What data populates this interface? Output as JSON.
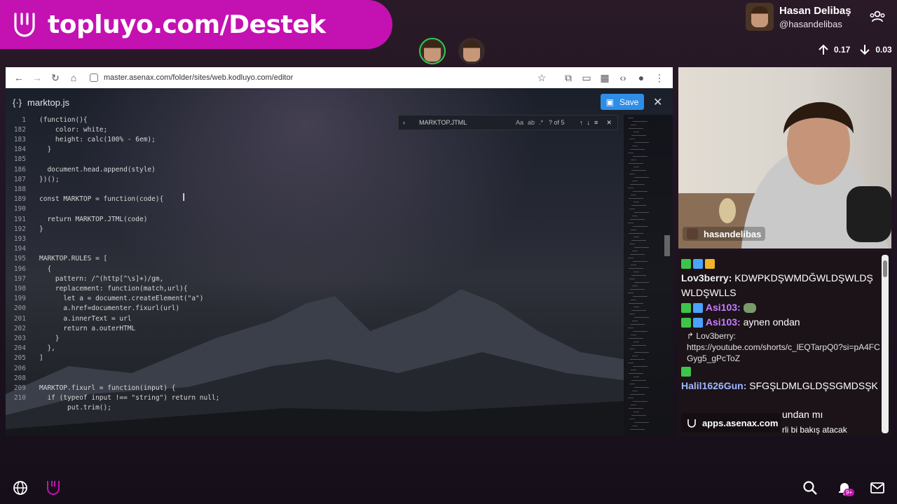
{
  "banner": {
    "text": "topluyo.com/Destek",
    "color": "#c411b2"
  },
  "profile": {
    "name": "Hasan Delibaş",
    "handle": "@hasandelibas"
  },
  "stats": {
    "upload": "0.17",
    "download": "0.03"
  },
  "browser": {
    "url": "master.asenax.com/folder/sites/web.kodluyo.com/editor"
  },
  "editor": {
    "file_name": "marktop.js",
    "save_label": "Save",
    "find": {
      "query": "MARKTOP.JTML",
      "count": "? of 5",
      "opt_case": "Aa",
      "opt_word": "ab",
      "opt_regex": ".*"
    },
    "lines": [
      {
        "n": "1",
        "t": "(function(){"
      },
      {
        "n": "182",
        "t": "    color: white;"
      },
      {
        "n": "183",
        "t": "    height: calc(100% - 6em);"
      },
      {
        "n": "184",
        "t": "  }"
      },
      {
        "n": "185",
        "t": ""
      },
      {
        "n": "186",
        "t": "  document.head.append(style)"
      },
      {
        "n": "187",
        "t": "})();"
      },
      {
        "n": "188",
        "t": ""
      },
      {
        "n": "189",
        "t": "const MARKTOP = function(code){"
      },
      {
        "n": "190",
        "t": ""
      },
      {
        "n": "191",
        "t": "  return MARKTOP.JTML(code)"
      },
      {
        "n": "192",
        "t": "}"
      },
      {
        "n": "193",
        "t": ""
      },
      {
        "n": "194",
        "t": ""
      },
      {
        "n": "195",
        "t": "MARKTOP.RULES = ["
      },
      {
        "n": "196",
        "t": "  {"
      },
      {
        "n": "197",
        "t": "    pattern: /^(http[^\\s]+)/gm,"
      },
      {
        "n": "198",
        "t": "    replacement: function(match,url){"
      },
      {
        "n": "199",
        "t": "      let a = document.createElement(\"a\")"
      },
      {
        "n": "200",
        "t": "      a.href=documenter.fixurl(url)"
      },
      {
        "n": "201",
        "t": "      a.innerText = url"
      },
      {
        "n": "202",
        "t": "      return a.outerHTML"
      },
      {
        "n": "203",
        "t": "    }"
      },
      {
        "n": "204",
        "t": "  },"
      },
      {
        "n": "205",
        "t": "]"
      },
      {
        "n": "206",
        "t": ""
      },
      {
        "n": "208",
        "t": ""
      },
      {
        "n": "209",
        "t": "MARKTOP.fixurl = function(input) {"
      },
      {
        "n": "210",
        "t": "  if (typeof input !== \"string\") return null;"
      },
      {
        "n": "",
        "t": "       put.trim();"
      }
    ],
    "cam_label": "hasandelibas"
  },
  "webcam": {
    "label": "hasandelibas"
  },
  "chat": {
    "messages": [
      {
        "user": "Lov3berry:",
        "text": "KDWPKDŞWMDĞWLDŞWLDŞWLDŞWLLS",
        "color": "#f2f2f2"
      },
      {
        "user": "Asi103:",
        "text": "",
        "color": "#c77dff"
      },
      {
        "user": "Asi103:",
        "text": "aynen ondan",
        "color": "#c77dff"
      },
      {
        "reply_to": "Lov3berry:",
        "reply_text": "https://youtube.com/shorts/c_lEQTarpQ0?si=pA4FCGyg5_gPcToZ"
      },
      {
        "user": "Halil1626Gun:",
        "text": "SFGŞLDMLGLDŞSGMDSŞK",
        "color": "#9fb8ff"
      },
      {
        "partial1": "undan mı",
        "partial2": "rli bi bakış atacak"
      }
    ]
  },
  "asenax": {
    "label": "apps.asenax.com"
  },
  "bottom": {
    "notif_count": "9+"
  }
}
